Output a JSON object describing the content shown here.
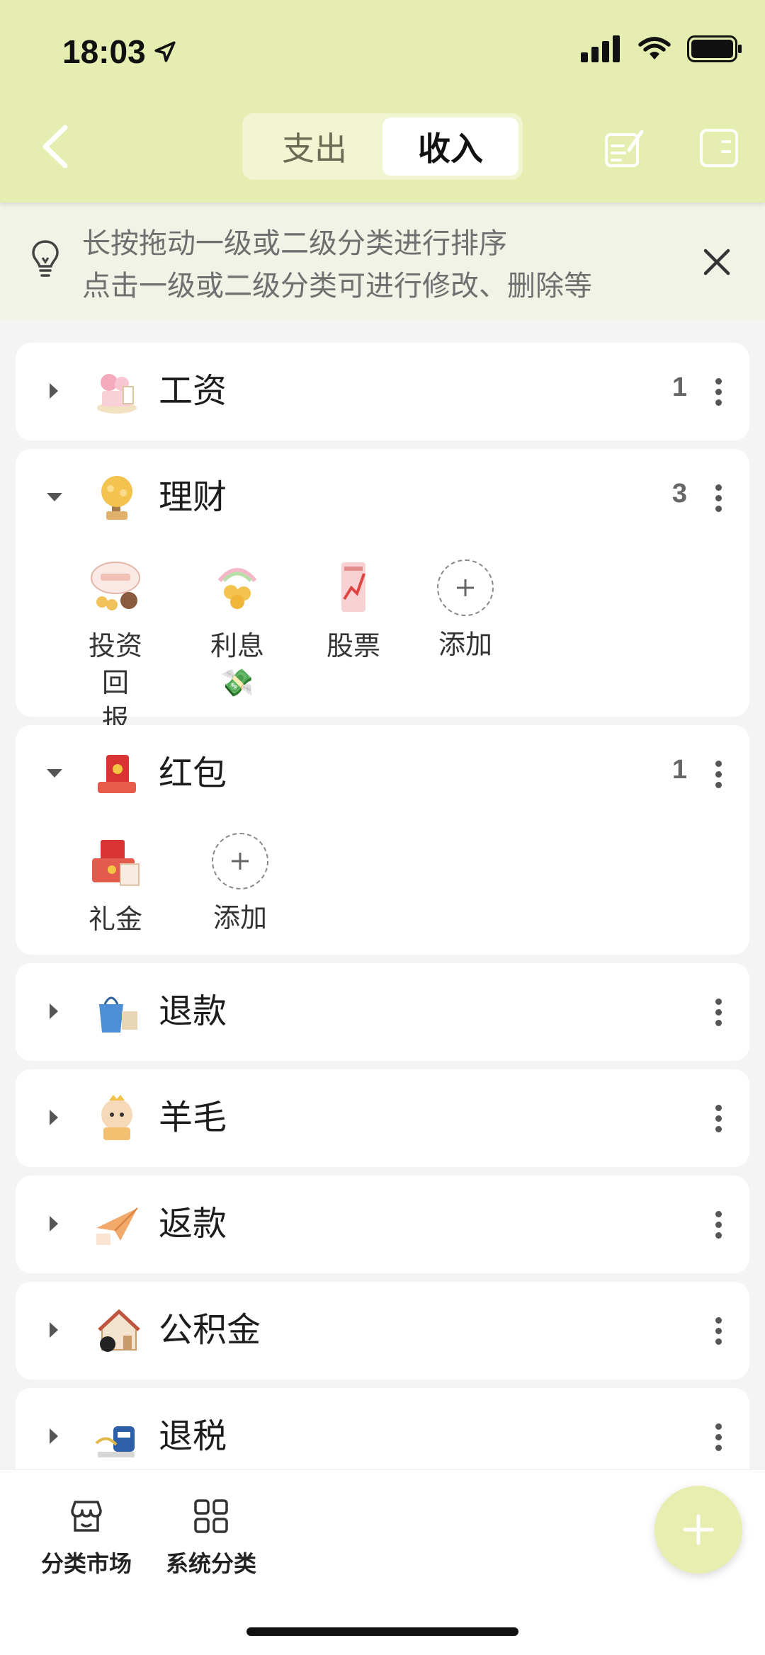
{
  "status": {
    "time": "18:03"
  },
  "header": {
    "tabs": [
      {
        "label": "支出"
      },
      {
        "label": "收入"
      }
    ],
    "active_tab": "收入"
  },
  "tip": {
    "line1": "长按拖动一级或二级分类进行排序",
    "line2": "点击一级或二级分类可进行修改、删除等"
  },
  "categories": [
    {
      "name": "工资",
      "count": "1",
      "expanded": false,
      "icon": "gift-box-icon"
    },
    {
      "name": "理财",
      "count": "3",
      "expanded": true,
      "icon": "money-tree-icon",
      "subs": [
        {
          "label": "投资回\n报",
          "icon": "investment-return-icon"
        },
        {
          "label": "利息💸",
          "icon": "interest-coins-icon"
        },
        {
          "label": "股票",
          "icon": "stock-chart-icon"
        }
      ]
    },
    {
      "name": "红包",
      "count": "1",
      "expanded": true,
      "icon": "red-envelope-icon",
      "subs": [
        {
          "label": "礼金",
          "icon": "gift-money-icon"
        }
      ]
    },
    {
      "name": "退款",
      "count": "",
      "expanded": false,
      "icon": "shopping-bag-icon"
    },
    {
      "name": "羊毛",
      "count": "",
      "expanded": false,
      "icon": "sheep-coupon-icon"
    },
    {
      "name": "返款",
      "count": "",
      "expanded": false,
      "icon": "paper-plane-icon"
    },
    {
      "name": "公积金",
      "count": "",
      "expanded": false,
      "icon": "house-icon"
    },
    {
      "name": "退税",
      "count": "",
      "expanded": false,
      "icon": "mailbox-icon"
    }
  ],
  "add_label": "添加",
  "bottom_nav": [
    {
      "label": "分类市场",
      "icon": "store-icon"
    },
    {
      "label": "系统分类",
      "icon": "category-grid-icon"
    }
  ],
  "colors": {
    "accent": "#e6edb0",
    "fab": "#e8eeb0"
  }
}
